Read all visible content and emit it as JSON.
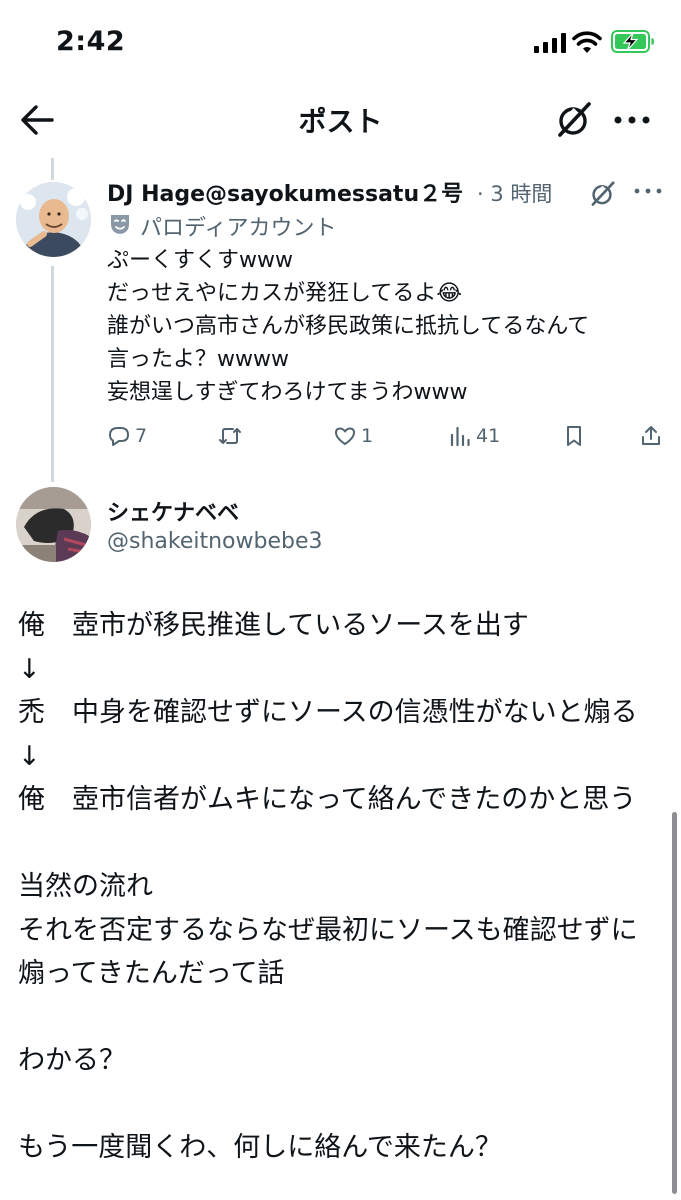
{
  "status_bar": {
    "time": "2:42"
  },
  "header": {
    "title": "ポスト"
  },
  "tweet1": {
    "display_name": "DJ Hage@sayokumessatu２号",
    "time": "· 3 時間",
    "parody_label": "パロディアカウント",
    "body": "ぷーくすくすwww\nだっせえやにカスが発狂してるよ😂\n誰がいつ高市さんが移民政策に抵抗してるなんて\n言ったよ？wwww\n妄想逞しすぎてわろけてまうわwww",
    "actions": {
      "replies": "7",
      "retweets": "",
      "likes": "1",
      "views": "41"
    }
  },
  "tweet2": {
    "display_name": "シェケナベベ",
    "handle": "@shakeitnowbebe3",
    "body": "俺　壺市が移民推進しているソースを出す\n↓\n禿　中身を確認せずにソースの信憑性がないと煽る\n↓\n俺　壺市信者がムキになって絡んできたのかと思う\n\n当然の流れ\nそれを否定するならなぜ最初にソースも確認せずに\n煽ってきたんだって話\n\nわかる？\n\nもう一度聞くわ、何しに絡んで来たん？"
  },
  "colors": {
    "text": "#0f1419",
    "secondary": "#536471",
    "thread": "#cfd9de",
    "battery": "#34c759"
  },
  "icons": [
    "back-arrow-icon",
    "grok-icon",
    "more-icon",
    "parody-mask-icon",
    "reply-icon",
    "retweet-icon",
    "like-icon",
    "views-icon",
    "bookmark-icon",
    "share-icon"
  ]
}
